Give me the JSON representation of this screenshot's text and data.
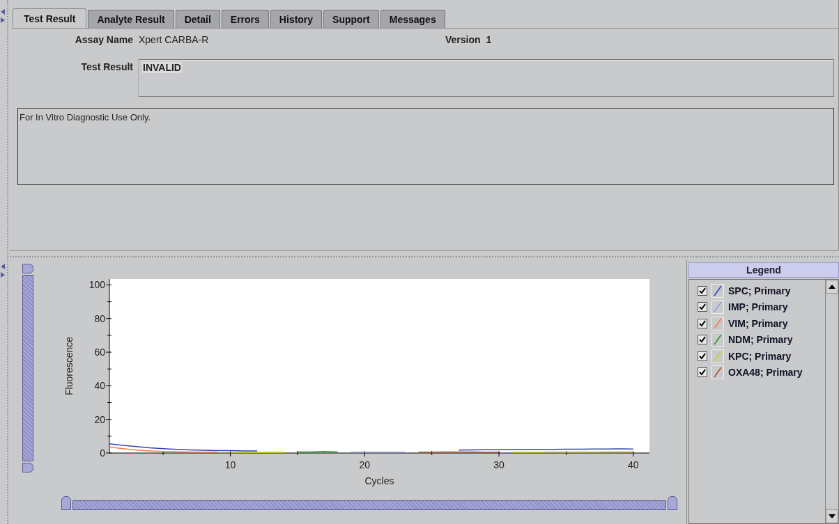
{
  "tabs": [
    {
      "label": "Test Result",
      "selected": true
    },
    {
      "label": "Analyte Result",
      "selected": false
    },
    {
      "label": "Detail",
      "selected": false
    },
    {
      "label": "Errors",
      "selected": false
    },
    {
      "label": "History",
      "selected": false
    },
    {
      "label": "Support",
      "selected": false
    },
    {
      "label": "Messages",
      "selected": false
    }
  ],
  "assay": {
    "label": "Assay Name",
    "value": "Xpert CARBA-R",
    "version_label": "Version",
    "version": "1"
  },
  "test_result": {
    "label": "Test Result",
    "value": "INVALID"
  },
  "notes": "For In Vitro Diagnostic Use Only.",
  "vertical_slider": {
    "level": 1
  },
  "chart_data": {
    "type": "line",
    "xlabel": "Cycles",
    "ylabel": "Fluorescence",
    "xlim": [
      1,
      41.2
    ],
    "ylim": [
      0,
      103.5
    ],
    "xticks": [
      10,
      20,
      30,
      40
    ],
    "yticks": [
      0,
      20,
      40,
      60,
      80,
      100
    ],
    "x": [
      1,
      2,
      3,
      4,
      5,
      6,
      7,
      8,
      9,
      10,
      11,
      12,
      13,
      14,
      15,
      16,
      17,
      18,
      19,
      20,
      21,
      22,
      23,
      24,
      25,
      26,
      27,
      28,
      29,
      30,
      31,
      32,
      33,
      34,
      35,
      36,
      37,
      38,
      39,
      40
    ],
    "series": [
      {
        "name": "SPC; Primary",
        "color": "#3344bb",
        "values": [
          5.5,
          4.6,
          3.8,
          3.1,
          2.6,
          2.2,
          1.9,
          1.7,
          1.5,
          1.4,
          1.3,
          1.2,
          null,
          null,
          null,
          null,
          null,
          null,
          null,
          null,
          null,
          null,
          null,
          null,
          null,
          null,
          1.8,
          1.9,
          2,
          2,
          2.1,
          2.1,
          2.2,
          2.2,
          2.3,
          2.3,
          2.4,
          2.4,
          2.5,
          2.4
        ]
      },
      {
        "name": "IMP; Primary",
        "color": "#9999dd",
        "values": [
          null,
          null,
          null,
          null,
          null,
          null,
          null,
          null,
          null,
          null,
          null,
          null,
          null,
          null,
          null,
          null,
          null,
          null,
          0.5,
          0.5,
          0.5,
          0.5,
          0.5,
          null,
          null,
          null,
          null,
          null,
          null,
          null,
          null,
          null,
          null,
          null,
          null,
          null,
          null,
          null,
          null,
          null
        ]
      },
      {
        "name": "VIM; Primary",
        "color": "#ff7744",
        "values": [
          3.6,
          2.6,
          1.8,
          1.3,
          0.9,
          0.7,
          0.6,
          0.5,
          0.5,
          null,
          null,
          null,
          null,
          null,
          null,
          null,
          null,
          null,
          null,
          null,
          null,
          null,
          null,
          null,
          null,
          null,
          null,
          null,
          null,
          null,
          null,
          null,
          null,
          null,
          null,
          null,
          null,
          null,
          null,
          null
        ]
      },
      {
        "name": "NDM; Primary",
        "color": "#229922",
        "values": [
          null,
          null,
          null,
          null,
          null,
          null,
          null,
          null,
          null,
          null,
          null,
          null,
          null,
          null,
          0.6,
          0.6,
          0.9,
          0.6,
          null,
          null,
          null,
          null,
          null,
          null,
          null,
          null,
          null,
          null,
          null,
          null,
          null,
          null,
          null,
          null,
          null,
          null,
          null,
          null,
          null,
          null
        ]
      },
      {
        "name": "KPC; Primary",
        "color": "#cccc22",
        "values": [
          null,
          null,
          null,
          null,
          null,
          null,
          null,
          null,
          null,
          0.4,
          0.4,
          0.4,
          0.4,
          0.4,
          null,
          null,
          null,
          null,
          null,
          null,
          null,
          null,
          null,
          null,
          null,
          null,
          null,
          null,
          null,
          null,
          0.5,
          0.5,
          0.5,
          0.6,
          0.6,
          0.6,
          0.6,
          0.7,
          0.7,
          0.7
        ]
      },
      {
        "name": "OXA48; Primary",
        "color": "#aa5522",
        "values": [
          null,
          null,
          null,
          null,
          null,
          null,
          null,
          null,
          null,
          null,
          null,
          null,
          null,
          null,
          null,
          null,
          null,
          null,
          null,
          null,
          null,
          null,
          null,
          0.5,
          0.5,
          0.6,
          0.6,
          0.6,
          0.5,
          0.5,
          null,
          null,
          null,
          null,
          null,
          null,
          null,
          null,
          null,
          null
        ]
      }
    ]
  },
  "horizontal_slider": {
    "level": 1
  },
  "legend": {
    "title": "Legend",
    "items": [
      {
        "checked": true
      },
      {
        "checked": true
      },
      {
        "checked": true
      },
      {
        "checked": true
      },
      {
        "checked": true
      },
      {
        "checked": true
      }
    ]
  }
}
